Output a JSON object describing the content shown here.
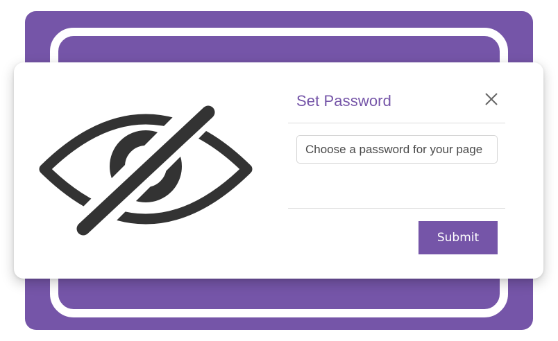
{
  "colors": {
    "accent": "#7555a8",
    "icon": "#333333",
    "background": "#ffffff"
  },
  "modal": {
    "title": "Set Password",
    "close_icon": "close-icon",
    "hero_icon": "eye-slash-icon",
    "password_field": {
      "placeholder": "Choose a password for your page",
      "value": ""
    },
    "submit_label": "Submit"
  }
}
